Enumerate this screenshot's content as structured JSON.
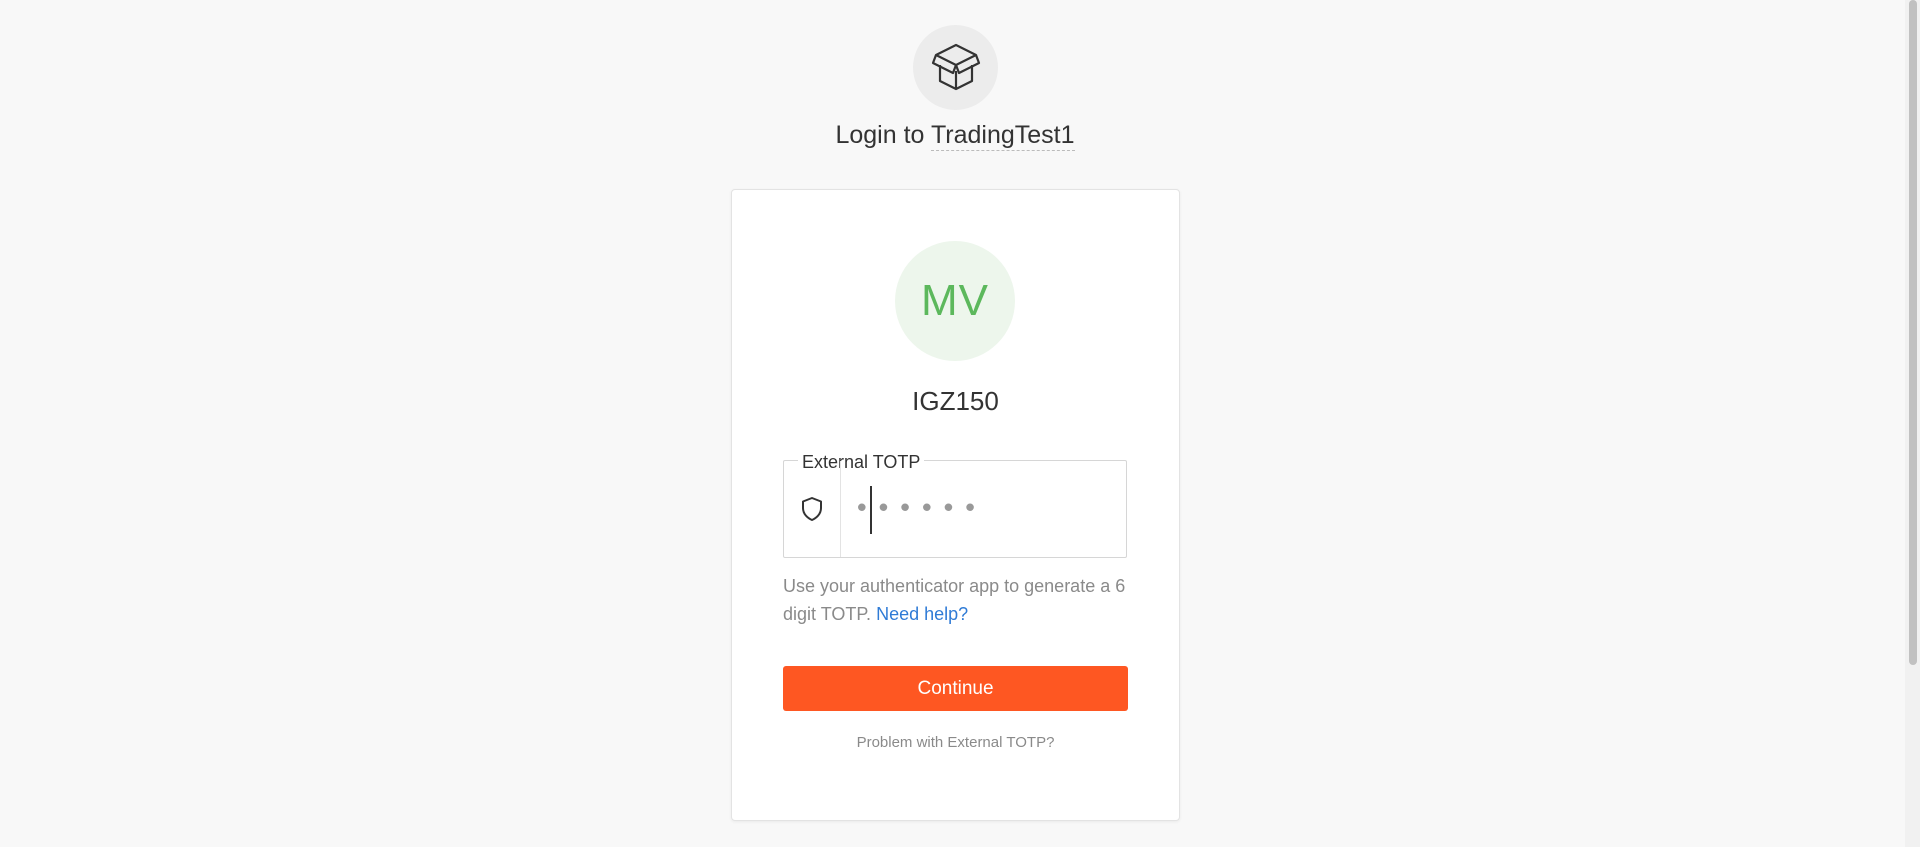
{
  "header": {
    "logo_icon": "open-box-icon",
    "title_prefix": "Login to",
    "app_name": "TradingTest1"
  },
  "card": {
    "avatar_initials": "MV",
    "avatar_color": "#5cb85c",
    "username": "IGZ150",
    "totp": {
      "legend": "External TOTP",
      "icon": "shield-icon",
      "value": "",
      "placeholder": "••••••"
    },
    "help_text": "Use your authenticator app to generate a 6 digit TOTP.",
    "help_link": "Need help?",
    "continue_label": "Continue",
    "continue_color": "#fe5722",
    "problem_link": "Problem with External TOTP?"
  }
}
